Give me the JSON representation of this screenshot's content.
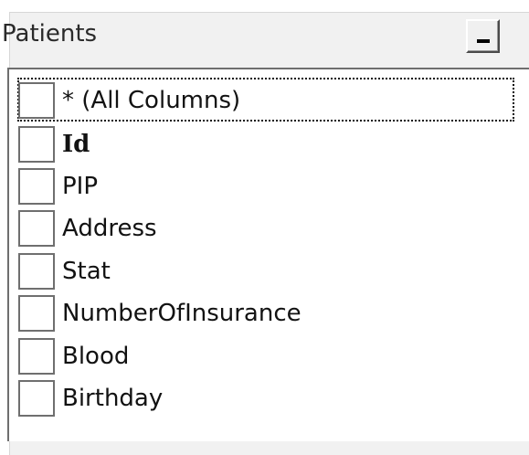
{
  "window": {
    "title": "Patients",
    "minimize_button": "_"
  },
  "columns": [
    {
      "label": "* (All Columns)",
      "checked": false,
      "focused": true,
      "bold": false
    },
    {
      "label": "Id",
      "checked": false,
      "focused": false,
      "bold": true
    },
    {
      "label": "PIP",
      "checked": false,
      "focused": false,
      "bold": false
    },
    {
      "label": "Address",
      "checked": false,
      "focused": false,
      "bold": false
    },
    {
      "label": "Stat",
      "checked": false,
      "focused": false,
      "bold": false
    },
    {
      "label": "NumberOfInsurance",
      "checked": false,
      "focused": false,
      "bold": false
    },
    {
      "label": "Blood",
      "checked": false,
      "focused": false,
      "bold": false
    },
    {
      "label": "Birthday",
      "checked": false,
      "focused": false,
      "bold": false
    }
  ]
}
